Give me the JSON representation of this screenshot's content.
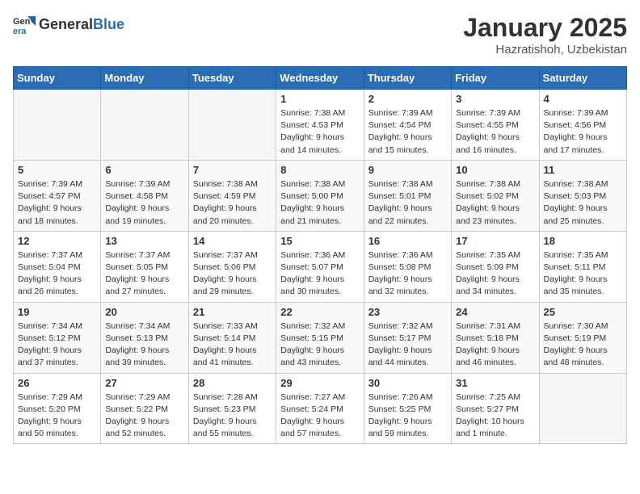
{
  "header": {
    "logo_general": "General",
    "logo_blue": "Blue",
    "month": "January 2025",
    "location": "Hazratishoh, Uzbekistan"
  },
  "weekdays": [
    "Sunday",
    "Monday",
    "Tuesday",
    "Wednesday",
    "Thursday",
    "Friday",
    "Saturday"
  ],
  "weeks": [
    [
      {
        "day": "",
        "sunrise": "",
        "sunset": "",
        "daylight": ""
      },
      {
        "day": "",
        "sunrise": "",
        "sunset": "",
        "daylight": ""
      },
      {
        "day": "",
        "sunrise": "",
        "sunset": "",
        "daylight": ""
      },
      {
        "day": "1",
        "sunrise": "Sunrise: 7:38 AM",
        "sunset": "Sunset: 4:53 PM",
        "daylight": "Daylight: 9 hours and 14 minutes."
      },
      {
        "day": "2",
        "sunrise": "Sunrise: 7:39 AM",
        "sunset": "Sunset: 4:54 PM",
        "daylight": "Daylight: 9 hours and 15 minutes."
      },
      {
        "day": "3",
        "sunrise": "Sunrise: 7:39 AM",
        "sunset": "Sunset: 4:55 PM",
        "daylight": "Daylight: 9 hours and 16 minutes."
      },
      {
        "day": "4",
        "sunrise": "Sunrise: 7:39 AM",
        "sunset": "Sunset: 4:56 PM",
        "daylight": "Daylight: 9 hours and 17 minutes."
      }
    ],
    [
      {
        "day": "5",
        "sunrise": "Sunrise: 7:39 AM",
        "sunset": "Sunset: 4:57 PM",
        "daylight": "Daylight: 9 hours and 18 minutes."
      },
      {
        "day": "6",
        "sunrise": "Sunrise: 7:39 AM",
        "sunset": "Sunset: 4:58 PM",
        "daylight": "Daylight: 9 hours and 19 minutes."
      },
      {
        "day": "7",
        "sunrise": "Sunrise: 7:38 AM",
        "sunset": "Sunset: 4:59 PM",
        "daylight": "Daylight: 9 hours and 20 minutes."
      },
      {
        "day": "8",
        "sunrise": "Sunrise: 7:38 AM",
        "sunset": "Sunset: 5:00 PM",
        "daylight": "Daylight: 9 hours and 21 minutes."
      },
      {
        "day": "9",
        "sunrise": "Sunrise: 7:38 AM",
        "sunset": "Sunset: 5:01 PM",
        "daylight": "Daylight: 9 hours and 22 minutes."
      },
      {
        "day": "10",
        "sunrise": "Sunrise: 7:38 AM",
        "sunset": "Sunset: 5:02 PM",
        "daylight": "Daylight: 9 hours and 23 minutes."
      },
      {
        "day": "11",
        "sunrise": "Sunrise: 7:38 AM",
        "sunset": "Sunset: 5:03 PM",
        "daylight": "Daylight: 9 hours and 25 minutes."
      }
    ],
    [
      {
        "day": "12",
        "sunrise": "Sunrise: 7:37 AM",
        "sunset": "Sunset: 5:04 PM",
        "daylight": "Daylight: 9 hours and 26 minutes."
      },
      {
        "day": "13",
        "sunrise": "Sunrise: 7:37 AM",
        "sunset": "Sunset: 5:05 PM",
        "daylight": "Daylight: 9 hours and 27 minutes."
      },
      {
        "day": "14",
        "sunrise": "Sunrise: 7:37 AM",
        "sunset": "Sunset: 5:06 PM",
        "daylight": "Daylight: 9 hours and 29 minutes."
      },
      {
        "day": "15",
        "sunrise": "Sunrise: 7:36 AM",
        "sunset": "Sunset: 5:07 PM",
        "daylight": "Daylight: 9 hours and 30 minutes."
      },
      {
        "day": "16",
        "sunrise": "Sunrise: 7:36 AM",
        "sunset": "Sunset: 5:08 PM",
        "daylight": "Daylight: 9 hours and 32 minutes."
      },
      {
        "day": "17",
        "sunrise": "Sunrise: 7:35 AM",
        "sunset": "Sunset: 5:09 PM",
        "daylight": "Daylight: 9 hours and 34 minutes."
      },
      {
        "day": "18",
        "sunrise": "Sunrise: 7:35 AM",
        "sunset": "Sunset: 5:11 PM",
        "daylight": "Daylight: 9 hours and 35 minutes."
      }
    ],
    [
      {
        "day": "19",
        "sunrise": "Sunrise: 7:34 AM",
        "sunset": "Sunset: 5:12 PM",
        "daylight": "Daylight: 9 hours and 37 minutes."
      },
      {
        "day": "20",
        "sunrise": "Sunrise: 7:34 AM",
        "sunset": "Sunset: 5:13 PM",
        "daylight": "Daylight: 9 hours and 39 minutes."
      },
      {
        "day": "21",
        "sunrise": "Sunrise: 7:33 AM",
        "sunset": "Sunset: 5:14 PM",
        "daylight": "Daylight: 9 hours and 41 minutes."
      },
      {
        "day": "22",
        "sunrise": "Sunrise: 7:32 AM",
        "sunset": "Sunset: 5:15 PM",
        "daylight": "Daylight: 9 hours and 43 minutes."
      },
      {
        "day": "23",
        "sunrise": "Sunrise: 7:32 AM",
        "sunset": "Sunset: 5:17 PM",
        "daylight": "Daylight: 9 hours and 44 minutes."
      },
      {
        "day": "24",
        "sunrise": "Sunrise: 7:31 AM",
        "sunset": "Sunset: 5:18 PM",
        "daylight": "Daylight: 9 hours and 46 minutes."
      },
      {
        "day": "25",
        "sunrise": "Sunrise: 7:30 AM",
        "sunset": "Sunset: 5:19 PM",
        "daylight": "Daylight: 9 hours and 48 minutes."
      }
    ],
    [
      {
        "day": "26",
        "sunrise": "Sunrise: 7:29 AM",
        "sunset": "Sunset: 5:20 PM",
        "daylight": "Daylight: 9 hours and 50 minutes."
      },
      {
        "day": "27",
        "sunrise": "Sunrise: 7:29 AM",
        "sunset": "Sunset: 5:22 PM",
        "daylight": "Daylight: 9 hours and 52 minutes."
      },
      {
        "day": "28",
        "sunrise": "Sunrise: 7:28 AM",
        "sunset": "Sunset: 5:23 PM",
        "daylight": "Daylight: 9 hours and 55 minutes."
      },
      {
        "day": "29",
        "sunrise": "Sunrise: 7:27 AM",
        "sunset": "Sunset: 5:24 PM",
        "daylight": "Daylight: 9 hours and 57 minutes."
      },
      {
        "day": "30",
        "sunrise": "Sunrise: 7:26 AM",
        "sunset": "Sunset: 5:25 PM",
        "daylight": "Daylight: 9 hours and 59 minutes."
      },
      {
        "day": "31",
        "sunrise": "Sunrise: 7:25 AM",
        "sunset": "Sunset: 5:27 PM",
        "daylight": "Daylight: 10 hours and 1 minute."
      },
      {
        "day": "",
        "sunrise": "",
        "sunset": "",
        "daylight": ""
      }
    ]
  ]
}
